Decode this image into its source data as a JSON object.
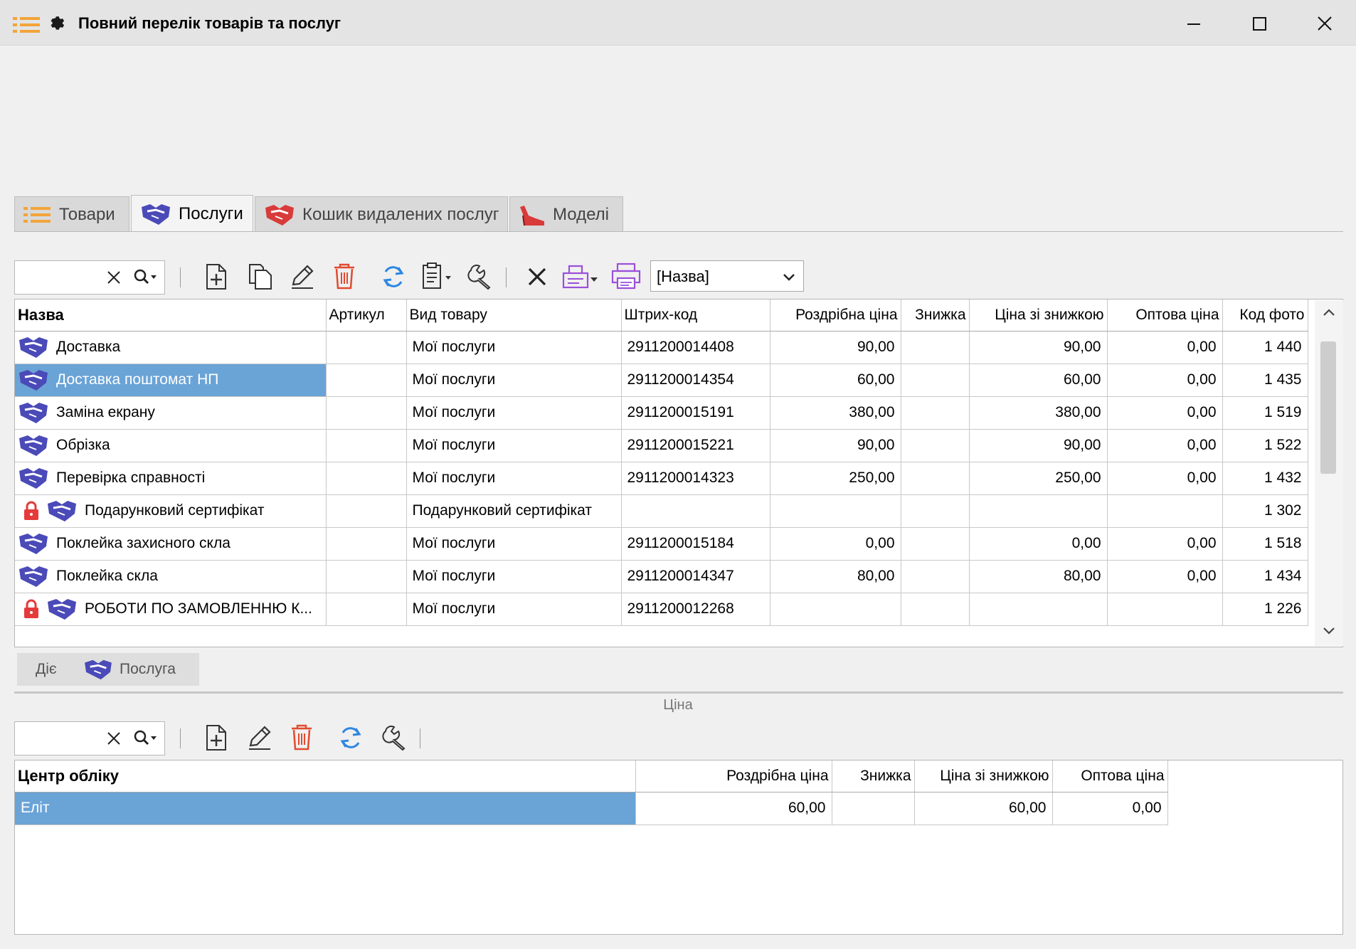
{
  "window": {
    "title": "Повний перелік товарів та послуг",
    "icons": [
      "list-icon",
      "gear-icon",
      "minimize-icon",
      "maximize-icon",
      "close-icon"
    ]
  },
  "tabs": [
    {
      "label": "Товари",
      "icon": "list-icon",
      "active": false
    },
    {
      "label": "Послуги",
      "icon": "handshake-icon",
      "active": true
    },
    {
      "label": "Кошик видалених послуг",
      "icon": "handshake-red-icon",
      "active": false
    },
    {
      "label": "Моделі",
      "icon": "shoe-icon",
      "active": false
    }
  ],
  "toolbar": {
    "search_value": "",
    "sort_combo_value": "[Назва]",
    "icons": [
      "clear-icon",
      "search-icon",
      "add-icon",
      "copy-icon",
      "edit-icon",
      "delete-icon",
      "refresh-icon",
      "clipboard-icon",
      "wrench-icon",
      "cancel-icon",
      "export-icon",
      "print-icon"
    ]
  },
  "services_grid": {
    "columns": [
      "Назва",
      "Артикул",
      "Вид товару",
      "Штрих-код",
      "Роздрібна ціна",
      "Знижка",
      "Ціна зі знижкою",
      "Оптова ціна",
      "Код фото"
    ],
    "rows": [
      {
        "name": "Доставка",
        "locked": false,
        "article": "",
        "type": "Мої послуги",
        "barcode": "2911200014408",
        "retail": "90,00",
        "discount": "",
        "discounted": "90,00",
        "wholesale": "0,00",
        "photo": "1 440",
        "selected": false
      },
      {
        "name": "Доставка поштомат НП",
        "locked": false,
        "article": "",
        "type": "Мої послуги",
        "barcode": "2911200014354",
        "retail": "60,00",
        "discount": "",
        "discounted": "60,00",
        "wholesale": "0,00",
        "photo": "1 435",
        "selected": true
      },
      {
        "name": "Заміна екрану",
        "locked": false,
        "article": "",
        "type": "Мої послуги",
        "barcode": "2911200015191",
        "retail": "380,00",
        "discount": "",
        "discounted": "380,00",
        "wholesale": "0,00",
        "photo": "1 519",
        "selected": false
      },
      {
        "name": "Обрізка",
        "locked": false,
        "article": "",
        "type": "Мої послуги",
        "barcode": "2911200015221",
        "retail": "90,00",
        "discount": "",
        "discounted": "90,00",
        "wholesale": "0,00",
        "photo": "1 522",
        "selected": false
      },
      {
        "name": "Перевірка справності",
        "locked": false,
        "article": "",
        "type": "Мої послуги",
        "barcode": "2911200014323",
        "retail": "250,00",
        "discount": "",
        "discounted": "250,00",
        "wholesale": "0,00",
        "photo": "1 432",
        "selected": false
      },
      {
        "name": "Подарунковий сертифікат",
        "locked": true,
        "article": "",
        "type": "Подарунковий сертифікат",
        "barcode": "",
        "retail": "",
        "discount": "",
        "discounted": "",
        "wholesale": "",
        "photo": "1 302",
        "selected": false
      },
      {
        "name": "Поклейка захисного скла",
        "locked": false,
        "article": "",
        "type": "Мої послуги",
        "barcode": "2911200015184",
        "retail": "0,00",
        "discount": "",
        "discounted": "0,00",
        "wholesale": "0,00",
        "photo": "1 518",
        "selected": false
      },
      {
        "name": "Поклейка скла",
        "locked": false,
        "article": "",
        "type": "Мої послуги",
        "barcode": "2911200014347",
        "retail": "80,00",
        "discount": "",
        "discounted": "80,00",
        "wholesale": "0,00",
        "photo": "1 434",
        "selected": false
      },
      {
        "name": "РОБОТИ ПО ЗАМОВЛЕННЮ К...",
        "locked": true,
        "article": "",
        "type": "Мої послуги",
        "barcode": "2911200012268",
        "retail": "",
        "discount": "",
        "discounted": "",
        "wholesale": "",
        "photo": "1 226",
        "selected": false
      }
    ]
  },
  "subtabs": [
    {
      "label": "Діє",
      "icon": null
    },
    {
      "label": "Послуга",
      "icon": "handshake-icon"
    }
  ],
  "price_section": {
    "title": "Ціна",
    "search_value": "",
    "columns": [
      "Центр обліку",
      "Роздрібна ціна",
      "Знижка",
      "Ціна зі знижкою",
      "Оптова ціна"
    ],
    "rows": [
      {
        "center": "Еліт",
        "retail": "60,00",
        "discount": "",
        "discounted": "60,00",
        "wholesale": "0,00",
        "selected": true
      }
    ]
  }
}
